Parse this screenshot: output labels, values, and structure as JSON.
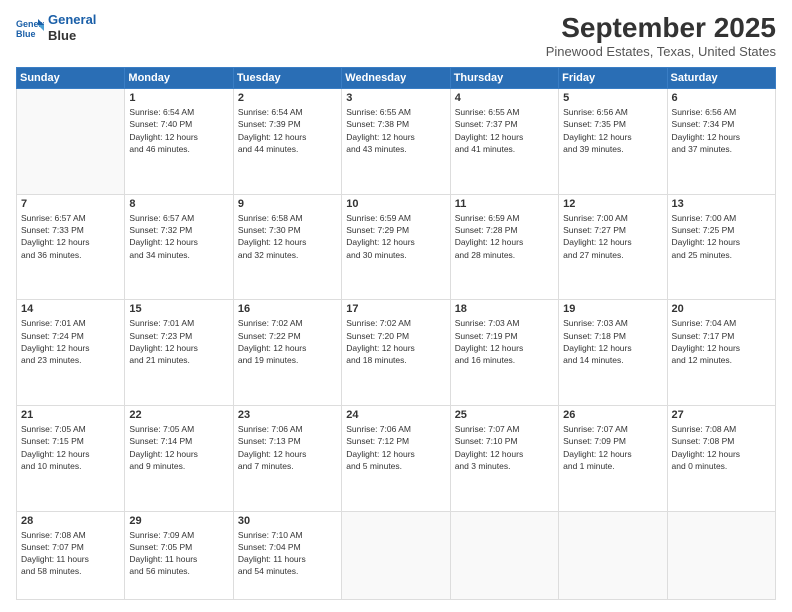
{
  "header": {
    "logo_line1": "General",
    "logo_line2": "Blue",
    "month": "September 2025",
    "location": "Pinewood Estates, Texas, United States"
  },
  "weekdays": [
    "Sunday",
    "Monday",
    "Tuesday",
    "Wednesday",
    "Thursday",
    "Friday",
    "Saturday"
  ],
  "weeks": [
    [
      {
        "day": "",
        "info": ""
      },
      {
        "day": "1",
        "info": "Sunrise: 6:54 AM\nSunset: 7:40 PM\nDaylight: 12 hours\nand 46 minutes."
      },
      {
        "day": "2",
        "info": "Sunrise: 6:54 AM\nSunset: 7:39 PM\nDaylight: 12 hours\nand 44 minutes."
      },
      {
        "day": "3",
        "info": "Sunrise: 6:55 AM\nSunset: 7:38 PM\nDaylight: 12 hours\nand 43 minutes."
      },
      {
        "day": "4",
        "info": "Sunrise: 6:55 AM\nSunset: 7:37 PM\nDaylight: 12 hours\nand 41 minutes."
      },
      {
        "day": "5",
        "info": "Sunrise: 6:56 AM\nSunset: 7:35 PM\nDaylight: 12 hours\nand 39 minutes."
      },
      {
        "day": "6",
        "info": "Sunrise: 6:56 AM\nSunset: 7:34 PM\nDaylight: 12 hours\nand 37 minutes."
      }
    ],
    [
      {
        "day": "7",
        "info": "Sunrise: 6:57 AM\nSunset: 7:33 PM\nDaylight: 12 hours\nand 36 minutes."
      },
      {
        "day": "8",
        "info": "Sunrise: 6:57 AM\nSunset: 7:32 PM\nDaylight: 12 hours\nand 34 minutes."
      },
      {
        "day": "9",
        "info": "Sunrise: 6:58 AM\nSunset: 7:30 PM\nDaylight: 12 hours\nand 32 minutes."
      },
      {
        "day": "10",
        "info": "Sunrise: 6:59 AM\nSunset: 7:29 PM\nDaylight: 12 hours\nand 30 minutes."
      },
      {
        "day": "11",
        "info": "Sunrise: 6:59 AM\nSunset: 7:28 PM\nDaylight: 12 hours\nand 28 minutes."
      },
      {
        "day": "12",
        "info": "Sunrise: 7:00 AM\nSunset: 7:27 PM\nDaylight: 12 hours\nand 27 minutes."
      },
      {
        "day": "13",
        "info": "Sunrise: 7:00 AM\nSunset: 7:25 PM\nDaylight: 12 hours\nand 25 minutes."
      }
    ],
    [
      {
        "day": "14",
        "info": "Sunrise: 7:01 AM\nSunset: 7:24 PM\nDaylight: 12 hours\nand 23 minutes."
      },
      {
        "day": "15",
        "info": "Sunrise: 7:01 AM\nSunset: 7:23 PM\nDaylight: 12 hours\nand 21 minutes."
      },
      {
        "day": "16",
        "info": "Sunrise: 7:02 AM\nSunset: 7:22 PM\nDaylight: 12 hours\nand 19 minutes."
      },
      {
        "day": "17",
        "info": "Sunrise: 7:02 AM\nSunset: 7:20 PM\nDaylight: 12 hours\nand 18 minutes."
      },
      {
        "day": "18",
        "info": "Sunrise: 7:03 AM\nSunset: 7:19 PM\nDaylight: 12 hours\nand 16 minutes."
      },
      {
        "day": "19",
        "info": "Sunrise: 7:03 AM\nSunset: 7:18 PM\nDaylight: 12 hours\nand 14 minutes."
      },
      {
        "day": "20",
        "info": "Sunrise: 7:04 AM\nSunset: 7:17 PM\nDaylight: 12 hours\nand 12 minutes."
      }
    ],
    [
      {
        "day": "21",
        "info": "Sunrise: 7:05 AM\nSunset: 7:15 PM\nDaylight: 12 hours\nand 10 minutes."
      },
      {
        "day": "22",
        "info": "Sunrise: 7:05 AM\nSunset: 7:14 PM\nDaylight: 12 hours\nand 9 minutes."
      },
      {
        "day": "23",
        "info": "Sunrise: 7:06 AM\nSunset: 7:13 PM\nDaylight: 12 hours\nand 7 minutes."
      },
      {
        "day": "24",
        "info": "Sunrise: 7:06 AM\nSunset: 7:12 PM\nDaylight: 12 hours\nand 5 minutes."
      },
      {
        "day": "25",
        "info": "Sunrise: 7:07 AM\nSunset: 7:10 PM\nDaylight: 12 hours\nand 3 minutes."
      },
      {
        "day": "26",
        "info": "Sunrise: 7:07 AM\nSunset: 7:09 PM\nDaylight: 12 hours\nand 1 minute."
      },
      {
        "day": "27",
        "info": "Sunrise: 7:08 AM\nSunset: 7:08 PM\nDaylight: 12 hours\nand 0 minutes."
      }
    ],
    [
      {
        "day": "28",
        "info": "Sunrise: 7:08 AM\nSunset: 7:07 PM\nDaylight: 11 hours\nand 58 minutes."
      },
      {
        "day": "29",
        "info": "Sunrise: 7:09 AM\nSunset: 7:05 PM\nDaylight: 11 hours\nand 56 minutes."
      },
      {
        "day": "30",
        "info": "Sunrise: 7:10 AM\nSunset: 7:04 PM\nDaylight: 11 hours\nand 54 minutes."
      },
      {
        "day": "",
        "info": ""
      },
      {
        "day": "",
        "info": ""
      },
      {
        "day": "",
        "info": ""
      },
      {
        "day": "",
        "info": ""
      }
    ]
  ]
}
